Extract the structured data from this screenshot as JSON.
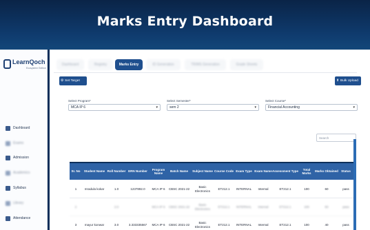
{
  "banner": {
    "title": "Marks Entry Dashboard"
  },
  "logo": {
    "name": "LearnQoch",
    "tagline": "Ecosystem Edition"
  },
  "sidebar": {
    "items": [
      {
        "label": "Dashboard",
        "icon": "grid-icon",
        "blurred": false
      },
      {
        "label": "Exams",
        "icon": "file-icon",
        "blurred": true
      },
      {
        "label": "Admission",
        "icon": "user-icon",
        "blurred": false
      },
      {
        "label": "Academics",
        "icon": "book-icon",
        "blurred": true
      },
      {
        "label": "Syllabus",
        "icon": "list-icon",
        "blurred": false
      },
      {
        "label": "Library",
        "icon": "library-icon",
        "blurred": true
      },
      {
        "label": "Attendance",
        "icon": "calendar-icon",
        "blurred": false
      }
    ]
  },
  "tabs": [
    {
      "label": "Dashboard",
      "active": false
    },
    {
      "label": "Registry",
      "active": false
    },
    {
      "label": "Marks Entry",
      "active": true
    },
    {
      "label": "ID Generation",
      "active": false
    },
    {
      "label": "TR/MS Generation",
      "active": false
    },
    {
      "label": "Grade Sheets",
      "active": false
    }
  ],
  "toolbar": {
    "set_target": "Set Target",
    "bulk_upload": "Bulk Upload"
  },
  "filters": {
    "program": {
      "label": "Select Program*",
      "value": "MCA IP 6"
    },
    "semester": {
      "label": "Select Semester*",
      "value": "sem 2"
    },
    "course": {
      "label": "Select Course*",
      "value": "Financial Accounting"
    }
  },
  "search": {
    "placeholder": "Search"
  },
  "table": {
    "headers": [
      "Sr. No",
      "Student Name",
      "Roll Number",
      "ERN Number",
      "Program Name",
      "Batch Name",
      "Subject Name",
      "Course Code",
      "Exam Type",
      "Exam Name",
      "Assessment Type",
      "Total Marks",
      "Marks Obtained",
      "Status"
    ],
    "rows": [
      {
        "blurred": false,
        "cells": [
          "1",
          "mradula kokar",
          "1.0",
          "1237892.0",
          "MCA IP 6",
          "CBSC 2021-22",
          "Basic Electronics",
          "ET212.1",
          "INTERNAL",
          "Internal",
          "ET212.1",
          "100",
          "60",
          "pass"
        ]
      },
      {
        "blurred": true,
        "cells": [
          "2",
          "",
          "2.0",
          "",
          "MCA IP 6",
          "CBSC 2021-22",
          "Basic Electronics",
          "ET212.1",
          "INTERNAL",
          "Internal",
          "ET212.1",
          "100",
          "60",
          "pass"
        ]
      },
      {
        "blurred": false,
        "cells": [
          "3",
          "mayur konwar",
          "3.0",
          "3.333335567",
          "MCA IP 6",
          "CBSC 2021-22",
          "Basic Electronics",
          "ET212.1",
          "INTERNAL",
          "Internal",
          "ET212.1",
          "100",
          "40",
          "pass"
        ]
      }
    ]
  },
  "colors": {
    "primary": "#1f4f8e",
    "header": "#2f63a6",
    "banner": "#0f3b6e"
  }
}
